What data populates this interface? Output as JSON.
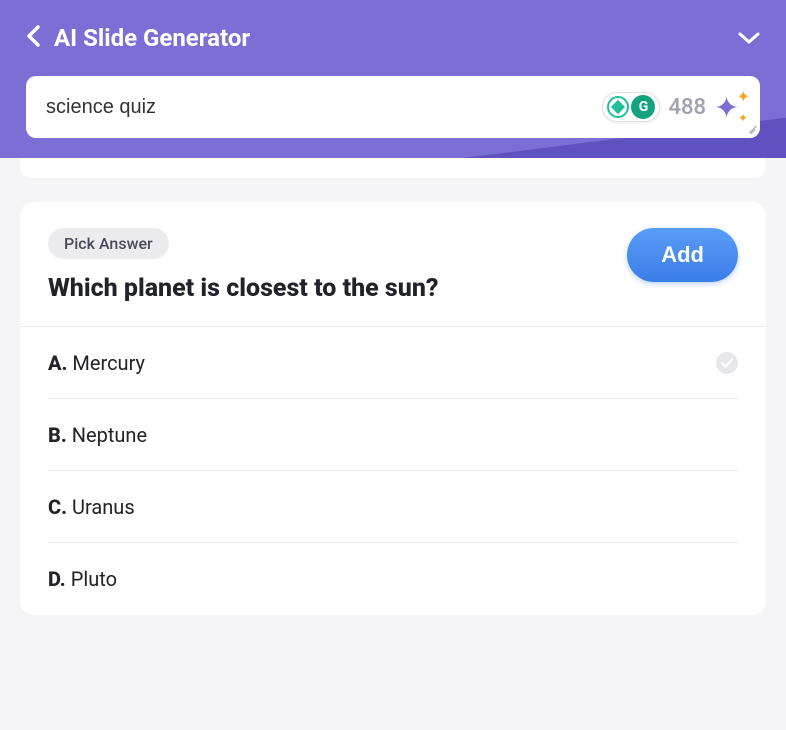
{
  "header": {
    "title": "AI Slide Generator"
  },
  "search": {
    "value": "science quiz",
    "count": "488"
  },
  "question": {
    "type_label": "Pick Answer",
    "text": "Which planet is closest to the sun?",
    "add_label": "Add",
    "options": [
      {
        "letter": "A.",
        "text": "Mercury",
        "checked": true
      },
      {
        "letter": "B.",
        "text": "Neptune",
        "checked": false
      },
      {
        "letter": "C.",
        "text": "Uranus",
        "checked": false
      },
      {
        "letter": "D.",
        "text": "Pluto",
        "checked": false
      }
    ]
  }
}
